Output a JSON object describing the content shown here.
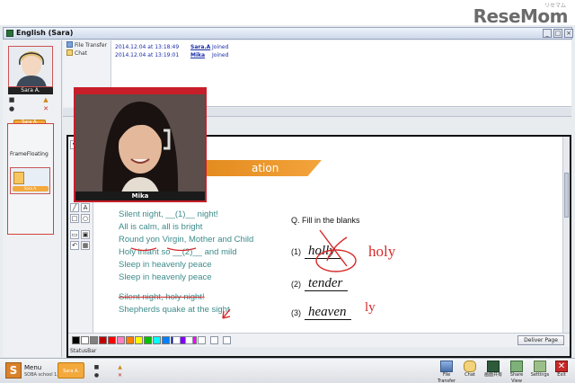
{
  "window": {
    "title": "English (Sara)"
  },
  "logo": {
    "text": "ReseMom",
    "small": "リセマム"
  },
  "left": {
    "user_name": "Sara A.",
    "orange_label": "Sara A.",
    "frame_label": "FrameFloating",
    "frame_pill": "Sara A."
  },
  "tabs": {
    "file_transfer": "File Transfer",
    "chat": "Chat"
  },
  "log": [
    {
      "time": "2014.12.04 at 13:18:49",
      "user": "Sara.A",
      "event": "Joined"
    },
    {
      "time": "2014.12.04 at 13:19:01",
      "user": "Mika",
      "event": "Joined"
    }
  ],
  "video": {
    "name": "Mika"
  },
  "lesson": {
    "banner": "ation",
    "poem": [
      "Silent night, __(1)__ night!",
      "All is calm, all is bright",
      "Round yon Virgin, Mother and Child",
      "Holy infant so __(2)__ and mild",
      "Sleep in heavenly peace",
      "Sleep in heavenly peace",
      "Silent night, holy night!",
      "Shepherds quake at the sight"
    ],
    "question": "Q.  Fill in the blanks",
    "answers": [
      {
        "num": "(1)",
        "word": "holly",
        "correction": "holy"
      },
      {
        "num": "(2)",
        "word": "tender",
        "correction": ""
      },
      {
        "num": "(3)",
        "word": "heaven",
        "correction": "ly"
      }
    ]
  },
  "palette": {
    "colors": [
      "#000000",
      "#ffffff",
      "#808080",
      "#c00000",
      "#ff0000",
      "#ff80c0",
      "#ff8000",
      "#ffff00",
      "#00c000",
      "#00ffff",
      "#0080ff",
      "#0000c0",
      "#8000ff",
      "#ff00ff"
    ],
    "deliver_label": "Deliver Page"
  },
  "status_bar": "StatusBar",
  "bottom": {
    "menu_label": "Menu",
    "version": "SOBA school 1.0.5",
    "orange_label": "Sara A.",
    "tools": [
      {
        "label": "File Transfer",
        "icon": "file-transfer-icon"
      },
      {
        "label": "Chat",
        "icon": "chat-icon"
      },
      {
        "label": "画面共有",
        "icon": "screen-share-icon"
      },
      {
        "label": "Share View",
        "icon": "share-view-icon"
      },
      {
        "label": "Settings",
        "icon": "settings-icon"
      },
      {
        "label": "Exit",
        "icon": "exit-icon"
      }
    ]
  }
}
